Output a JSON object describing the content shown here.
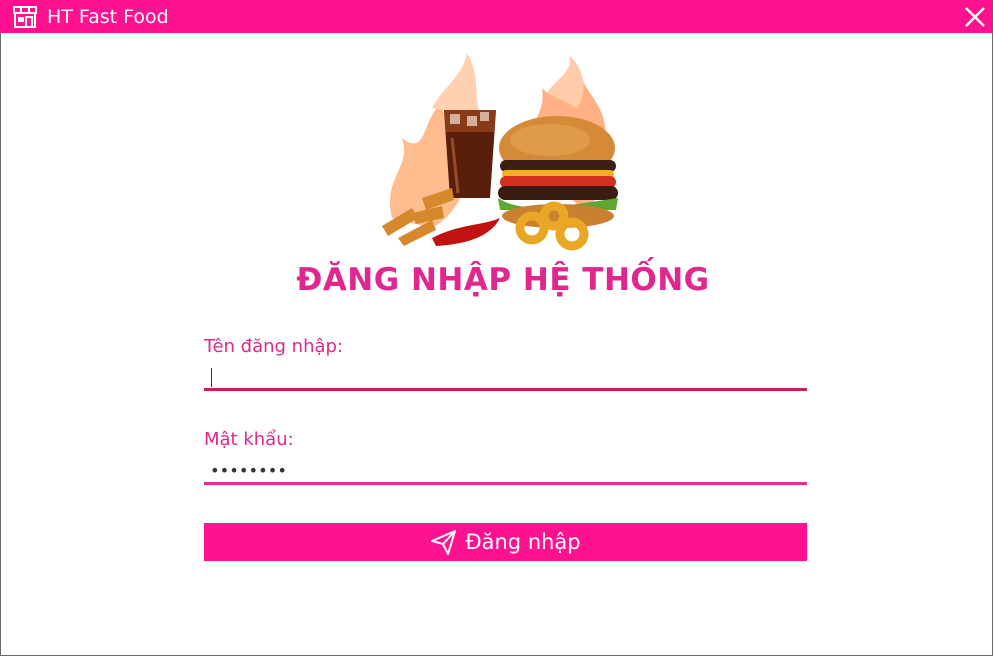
{
  "window": {
    "title": "HT Fast Food",
    "accent_color": "#fe128f",
    "icon": "store-icon",
    "close_icon": "close-icon"
  },
  "hero": {
    "image": "fast-food-combo-image"
  },
  "login": {
    "heading": "ĐĂNG NHẬP HỆ THỐNG",
    "username_label": "Tên đăng nhập:",
    "username_value": "",
    "password_label": "Mật khẩu:",
    "password_value": "••••••••",
    "submit_label": "Đăng nhập",
    "submit_icon": "send-icon"
  }
}
